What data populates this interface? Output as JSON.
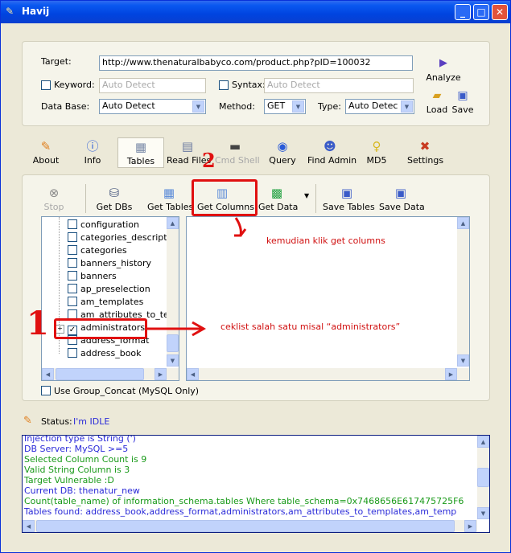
{
  "window": {
    "title": "Havij"
  },
  "form": {
    "target_label": "Target:",
    "target_value": "http://www.thenaturalbabyco.com/product.php?pID=100032",
    "keyword_label": "Keyword:",
    "keyword_placeholder": "Auto Detect",
    "syntax_label": "Syntax:",
    "syntax_placeholder": "Auto Detect",
    "database_label": "Data Base:",
    "database_value": "Auto Detect",
    "method_label": "Method:",
    "method_value": "GET",
    "type_label": "Type:",
    "type_value": "Auto Detec",
    "analyze_label": "Analyze",
    "load_label": "Load",
    "save_label": "Save"
  },
  "tabs": [
    {
      "label": "About",
      "icon": "about-icon"
    },
    {
      "label": "Info",
      "icon": "info-icon"
    },
    {
      "label": "Tables",
      "icon": "tables-icon"
    },
    {
      "label": "Read Files",
      "icon": "read-files-icon"
    },
    {
      "label": "Cmd Shell",
      "icon": "cmd-shell-icon"
    },
    {
      "label": "Query",
      "icon": "query-icon"
    },
    {
      "label": "Find Admin",
      "icon": "find-admin-icon"
    },
    {
      "label": "MD5",
      "icon": "md5-icon"
    },
    {
      "label": "Settings",
      "icon": "settings-icon"
    }
  ],
  "toolbar": {
    "stop": "Stop",
    "get_dbs": "Get DBs",
    "get_tables": "Get Tables",
    "get_columns": "Get Columns",
    "get_data": "Get Data",
    "save_tables": "Save Tables",
    "save_data": "Save Data"
  },
  "tree": {
    "items": [
      {
        "label": "configuration",
        "checked": false
      },
      {
        "label": "categories_description",
        "checked": false
      },
      {
        "label": "categories",
        "checked": false
      },
      {
        "label": "banners_history",
        "checked": false
      },
      {
        "label": "banners",
        "checked": false
      },
      {
        "label": "ap_preselection",
        "checked": false
      },
      {
        "label": "am_templates",
        "checked": false
      },
      {
        "label": "am_attributes_to_temp",
        "checked": false
      },
      {
        "label": "administrators",
        "checked": true
      },
      {
        "label": "address_format",
        "checked": false
      },
      {
        "label": "address_book",
        "checked": false
      }
    ]
  },
  "options": {
    "group_concat_label": "Use Group_Concat (MySQL Only)"
  },
  "status": {
    "label": "Status:",
    "value": "I'm IDLE"
  },
  "log": {
    "lines": [
      {
        "text": "Injection type is String (')",
        "color": "#2a2ad8"
      },
      {
        "text": "DB Server: MySQL >=5",
        "color": "#2a2ad8"
      },
      {
        "text": "Selected Column Count is 9",
        "color": "#1a9a1a"
      },
      {
        "text": "Valid String Column is 3",
        "color": "#1a9a1a"
      },
      {
        "text": "Target Vulnerable :D",
        "color": "#1a9a1a"
      },
      {
        "text": "Current DB: thenatur_new",
        "color": "#2a2ad8"
      },
      {
        "text": "Count(table_name) of information_schema.tables Where table_schema=0x7468656E617475725F6",
        "color": "#1a9a1a"
      },
      {
        "text": "Tables found: address_book,address_format,administrators,am_attributes_to_templates,am_temp",
        "color": "#2a2ad8"
      }
    ]
  },
  "annotations": {
    "step1_number": "1",
    "step2_number": "2",
    "step1_note": "ceklist salah satu misal “administrators”",
    "step2_note": "kemudian klik get columns"
  },
  "colors": {
    "annotation_red": "#e01010",
    "titlebar_blue": "#0a58f0",
    "log_green": "#1a9a1a",
    "log_blue": "#2a2ad8"
  }
}
